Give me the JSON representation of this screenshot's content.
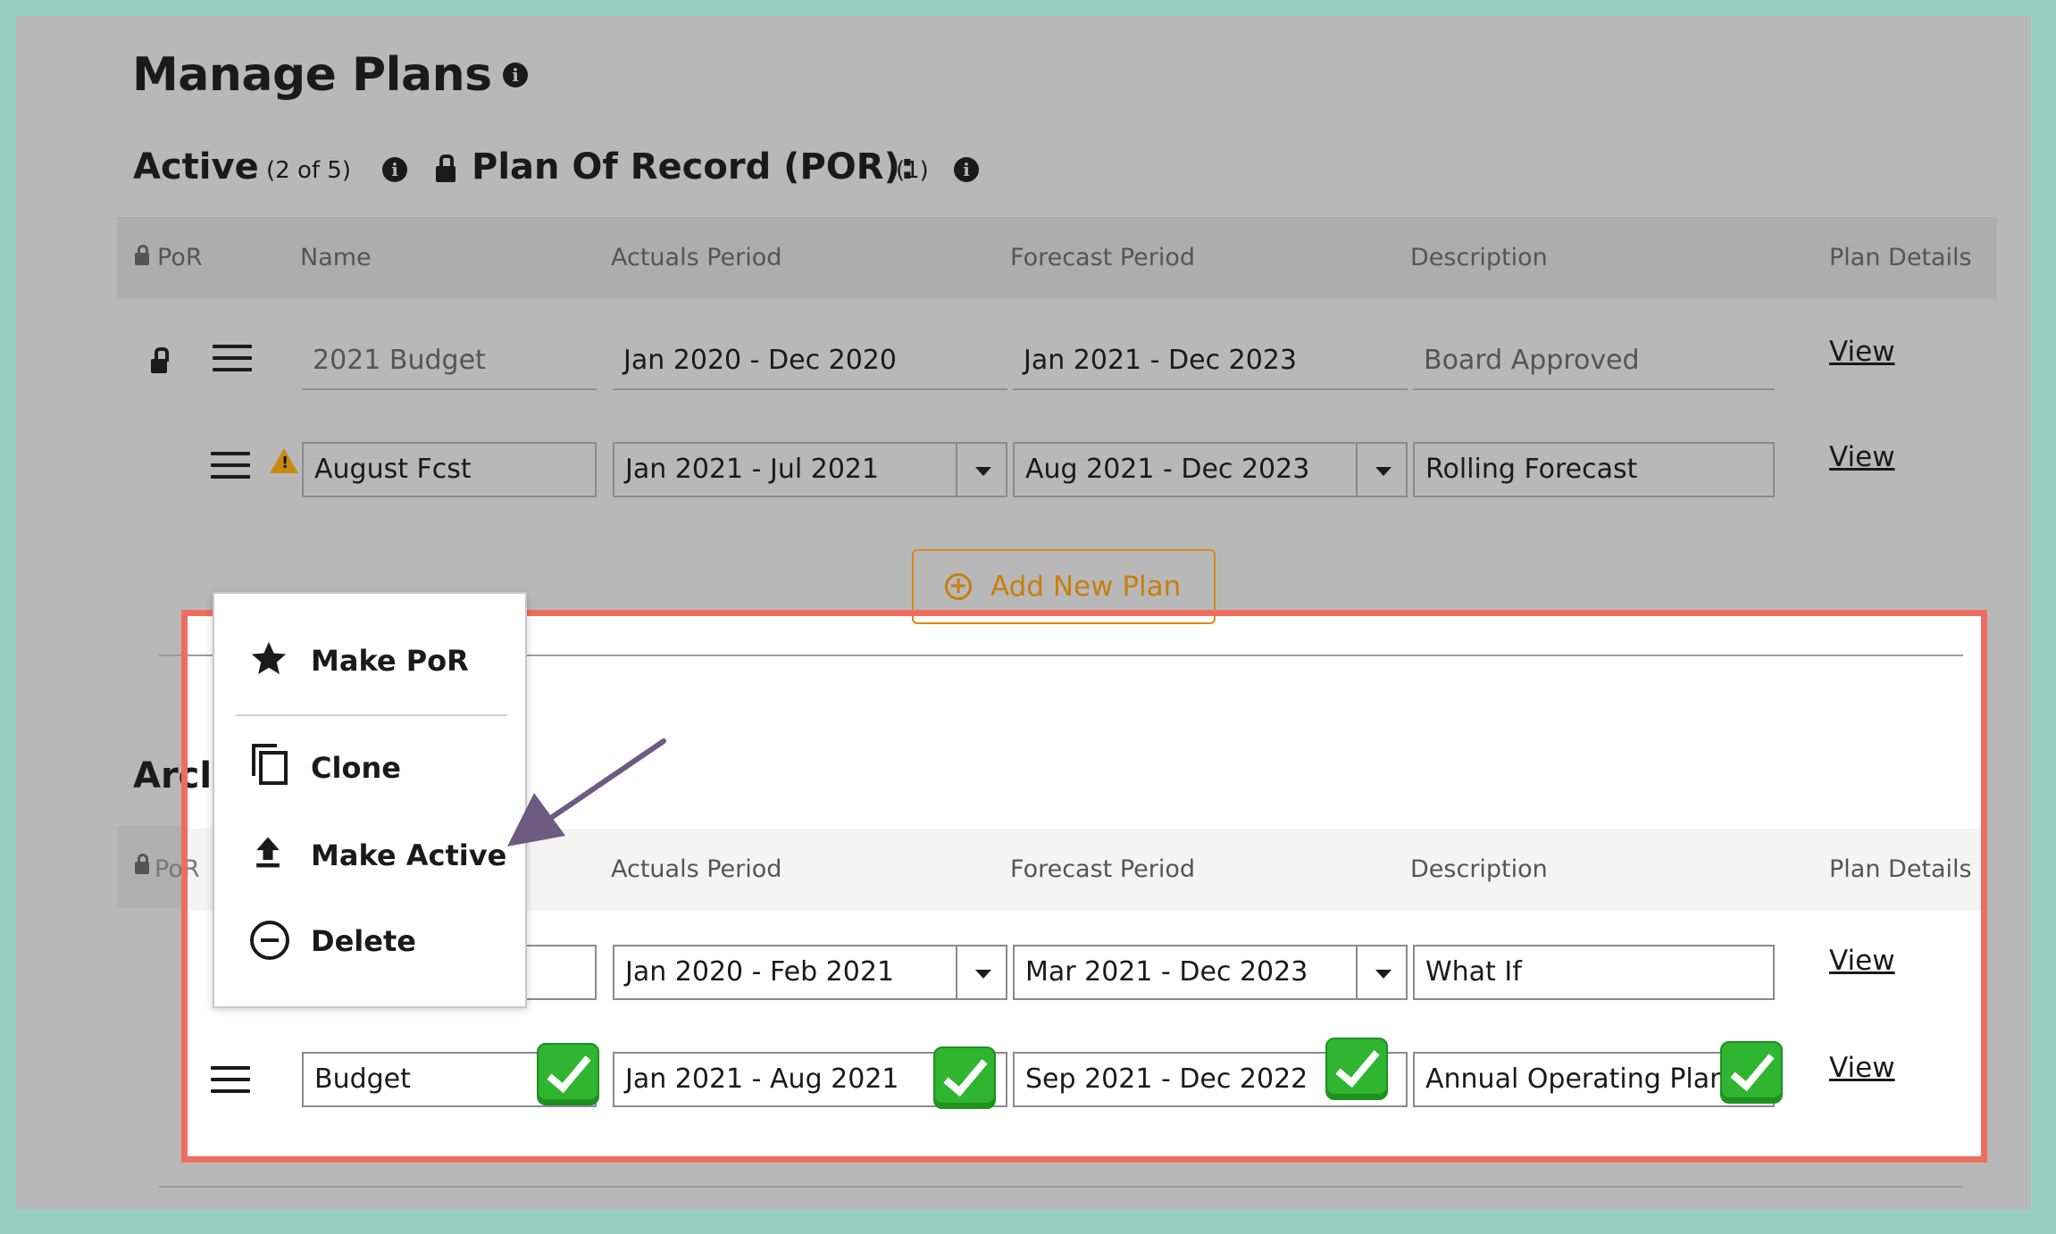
{
  "page": {
    "title": "Manage Plans"
  },
  "active": {
    "heading": "Active",
    "count": "(2 of 5)",
    "por_heading": "Plan Of Record (POR):",
    "por_count": "(1)"
  },
  "columns": {
    "por": "PoR",
    "name": "Name",
    "actuals": "Actuals Period",
    "forecast": "Forecast Period",
    "description": "Description",
    "details": "Plan Details"
  },
  "active_rows": [
    {
      "name": "2021 Budget",
      "actuals": "Jan 2020 - Dec 2020",
      "forecast": "Jan 2021 - Dec 2023",
      "description": "Board Approved",
      "link": "View"
    },
    {
      "name": "August Fcst",
      "actuals": "Jan 2021 - Jul 2021",
      "forecast": "Aug 2021 - Dec 2023",
      "description": "Rolling Forecast",
      "link": "View"
    }
  ],
  "add_button": "Add New Plan",
  "archived": {
    "heading_partial": "Arcl"
  },
  "archived_rows": [
    {
      "name": "",
      "actuals": "Jan 2020 - Feb 2021",
      "forecast": "Mar 2021 - Dec 2023",
      "description": "What If",
      "link": "View"
    },
    {
      "name": "Budget",
      "actuals": "Jan 2021 - Aug 2021",
      "forecast": "Sep 2021 - Dec 2022",
      "description": "Annual Operating Plan",
      "link": "View"
    }
  ],
  "context_menu": {
    "make_por": "Make PoR",
    "clone": "Clone",
    "make_active": "Make Active",
    "delete": "Delete"
  },
  "colors": {
    "highlight": "#ee6d5f",
    "accent": "#c87e0e",
    "arrow": "#6e5a80",
    "check": "#2fb52f"
  }
}
